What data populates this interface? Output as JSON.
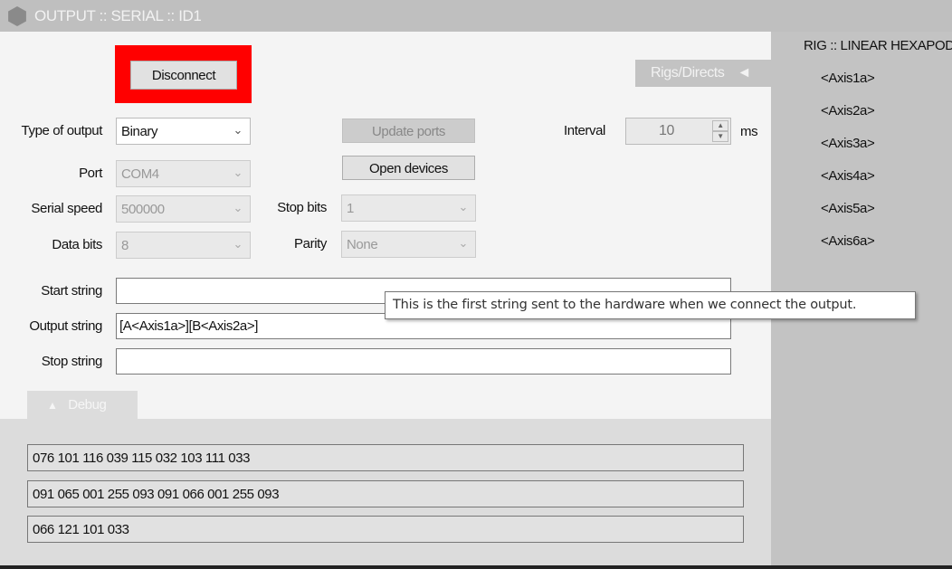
{
  "window": {
    "title": "OUTPUT :: SERIAL :: ID1"
  },
  "disconnect_label": "Disconnect",
  "rigs_tab": {
    "label": "Rigs/Directs",
    "arrow": "◄"
  },
  "form": {
    "type_of_output": {
      "label": "Type of output",
      "value": "Binary"
    },
    "port": {
      "label": "Port",
      "value": "COM4"
    },
    "serial_speed": {
      "label": "Serial speed",
      "value": "500000"
    },
    "data_bits": {
      "label": "Data bits",
      "value": "8"
    },
    "stop_bits": {
      "label": "Stop bits",
      "value": "1"
    },
    "parity": {
      "label": "Parity",
      "value": "None"
    },
    "update_ports_label": "Update ports",
    "open_devices_label": "Open devices",
    "interval": {
      "label": "Interval",
      "value": "10",
      "unit": "ms"
    },
    "start_string": {
      "label": "Start string",
      "value": ""
    },
    "output_string": {
      "label": "Output string",
      "value": "[A<Axis1a>][B<Axis2a>]"
    },
    "stop_string": {
      "label": "Stop string",
      "value": ""
    }
  },
  "tooltip": "This is the first string sent to the hardware when we connect the output.",
  "debug": {
    "tab_label": "Debug",
    "arrow": "▲",
    "lines": [
      "076 101 116 039 115 032 103 111 033",
      "091 065 001 255 093 091 066 001 255 093",
      "066 121 101 033"
    ]
  },
  "rig": {
    "title": "RIG :: LINEAR HEXAPOD",
    "axes": [
      "<Axis1a>",
      "<Axis2a>",
      "<Axis3a>",
      "<Axis4a>",
      "<Axis5a>",
      "<Axis6a>"
    ]
  },
  "colors": {
    "highlight": "#ff0000"
  }
}
